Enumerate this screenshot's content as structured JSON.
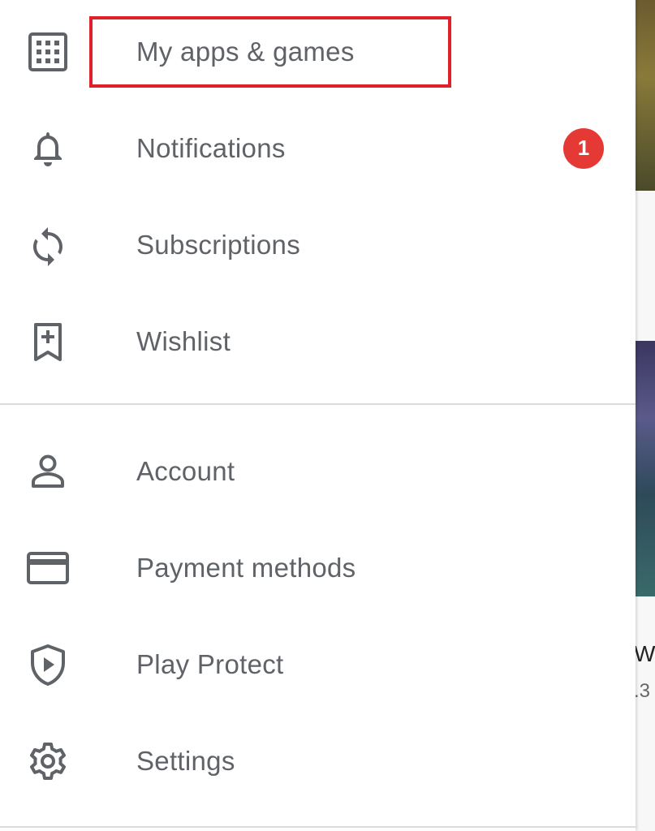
{
  "drawer": {
    "items": [
      {
        "label": "My apps & games",
        "icon": "grid-icon"
      },
      {
        "label": "Notifications",
        "icon": "bell-icon",
        "badge": "1"
      },
      {
        "label": "Subscriptions",
        "icon": "refresh-icon"
      },
      {
        "label": "Wishlist",
        "icon": "bookmark-add-icon"
      },
      {
        "label": "Account",
        "icon": "person-icon"
      },
      {
        "label": "Payment methods",
        "icon": "credit-card-icon"
      },
      {
        "label": "Play Protect",
        "icon": "shield-play-icon"
      },
      {
        "label": "Settings",
        "icon": "gear-icon"
      }
    ]
  },
  "background": {
    "partial_title": "Wo",
    "partial_rating": ".3"
  },
  "colors": {
    "icon": "#5f6368",
    "label": "#5f6368",
    "badge": "#e53935",
    "highlight": "#e0202b",
    "divider": "#dadce0"
  }
}
